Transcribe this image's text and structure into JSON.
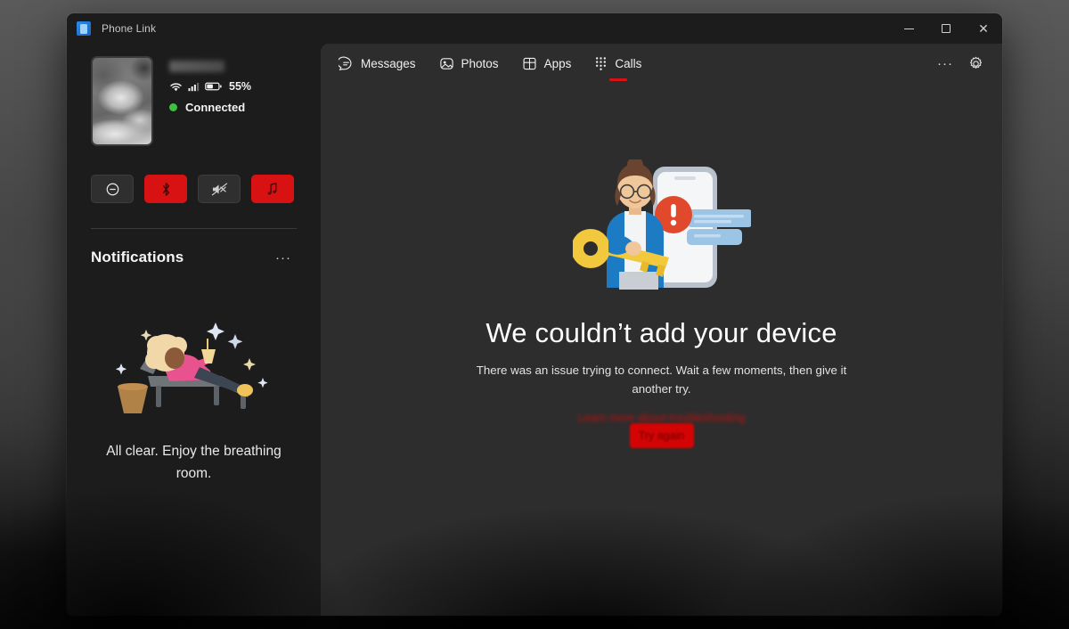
{
  "window": {
    "title": "Phone Link",
    "logo_icon": "phone-link-logo-icon",
    "controls": {
      "minimize": "minimize-icon",
      "maximize": "maximize-icon",
      "close": "close-icon"
    }
  },
  "sidebar": {
    "device": {
      "thumbnail_alt": "phone-wallpaper-thumbnail",
      "name": "",
      "name_redacted": true,
      "wifi_icon": "wifi-icon",
      "signal_icon": "cellular-signal-icon",
      "battery_icon": "battery-icon",
      "battery_percent": "55%",
      "connection_status": "Connected",
      "connection_dot_color": "#3ec13e"
    },
    "quick_actions": [
      {
        "name": "do-not-disturb-button",
        "icon": "do-not-disturb-icon",
        "active": false
      },
      {
        "name": "bluetooth-button",
        "icon": "bluetooth-icon",
        "active": true
      },
      {
        "name": "mute-button",
        "icon": "volume-mute-icon",
        "active": false
      },
      {
        "name": "media-button",
        "icon": "music-note-icon",
        "active": true
      }
    ],
    "notifications": {
      "title": "Notifications",
      "more_label": "···",
      "empty_illustration": "person-relaxing-lounge-chair-illustration",
      "empty_text": "All clear. Enjoy the breathing room."
    }
  },
  "main": {
    "tabs": [
      {
        "label": "Messages",
        "icon": "messages-icon",
        "active": false
      },
      {
        "label": "Photos",
        "icon": "photos-icon",
        "active": false
      },
      {
        "label": "Apps",
        "icon": "apps-grid-icon",
        "active": false
      },
      {
        "label": "Calls",
        "icon": "dialpad-icon",
        "active": true
      }
    ],
    "toolbar": {
      "more_label": "···",
      "more_icon": "more-options-icon",
      "settings_icon": "gear-icon"
    },
    "error": {
      "illustration": "woman-with-key-and-phone-error-illustration",
      "title": "We couldn’t add your device",
      "description": "There was an issue trying to connect. Wait a few moments, then give it another try.",
      "retry_label": "Try again",
      "retry_color": "#d40404",
      "help_link_label": "Learn more about troubleshooting",
      "help_link_color": "#c01010",
      "help_link_redacted": true
    }
  }
}
